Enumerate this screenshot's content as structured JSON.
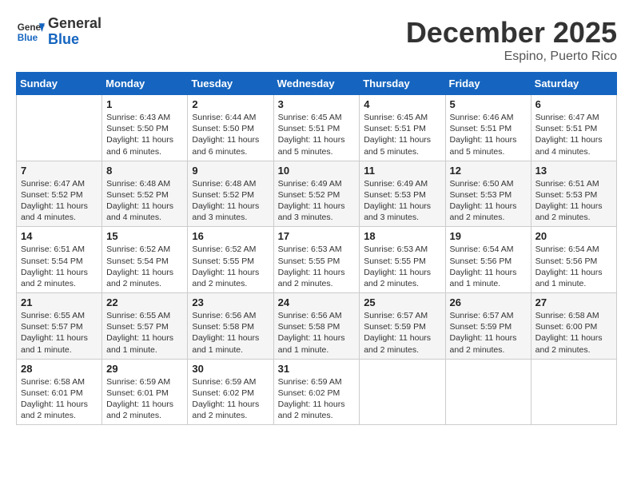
{
  "header": {
    "logo_general": "General",
    "logo_blue": "Blue",
    "month_title": "December 2025",
    "location": "Espino, Puerto Rico"
  },
  "days_of_week": [
    "Sunday",
    "Monday",
    "Tuesday",
    "Wednesday",
    "Thursday",
    "Friday",
    "Saturday"
  ],
  "weeks": [
    [
      {
        "day": "",
        "info": ""
      },
      {
        "day": "1",
        "info": "Sunrise: 6:43 AM\nSunset: 5:50 PM\nDaylight: 11 hours\nand 6 minutes."
      },
      {
        "day": "2",
        "info": "Sunrise: 6:44 AM\nSunset: 5:50 PM\nDaylight: 11 hours\nand 6 minutes."
      },
      {
        "day": "3",
        "info": "Sunrise: 6:45 AM\nSunset: 5:51 PM\nDaylight: 11 hours\nand 5 minutes."
      },
      {
        "day": "4",
        "info": "Sunrise: 6:45 AM\nSunset: 5:51 PM\nDaylight: 11 hours\nand 5 minutes."
      },
      {
        "day": "5",
        "info": "Sunrise: 6:46 AM\nSunset: 5:51 PM\nDaylight: 11 hours\nand 5 minutes."
      },
      {
        "day": "6",
        "info": "Sunrise: 6:47 AM\nSunset: 5:51 PM\nDaylight: 11 hours\nand 4 minutes."
      }
    ],
    [
      {
        "day": "7",
        "info": "Sunrise: 6:47 AM\nSunset: 5:52 PM\nDaylight: 11 hours\nand 4 minutes."
      },
      {
        "day": "8",
        "info": "Sunrise: 6:48 AM\nSunset: 5:52 PM\nDaylight: 11 hours\nand 4 minutes."
      },
      {
        "day": "9",
        "info": "Sunrise: 6:48 AM\nSunset: 5:52 PM\nDaylight: 11 hours\nand 3 minutes."
      },
      {
        "day": "10",
        "info": "Sunrise: 6:49 AM\nSunset: 5:52 PM\nDaylight: 11 hours\nand 3 minutes."
      },
      {
        "day": "11",
        "info": "Sunrise: 6:49 AM\nSunset: 5:53 PM\nDaylight: 11 hours\nand 3 minutes."
      },
      {
        "day": "12",
        "info": "Sunrise: 6:50 AM\nSunset: 5:53 PM\nDaylight: 11 hours\nand 2 minutes."
      },
      {
        "day": "13",
        "info": "Sunrise: 6:51 AM\nSunset: 5:53 PM\nDaylight: 11 hours\nand 2 minutes."
      }
    ],
    [
      {
        "day": "14",
        "info": "Sunrise: 6:51 AM\nSunset: 5:54 PM\nDaylight: 11 hours\nand 2 minutes."
      },
      {
        "day": "15",
        "info": "Sunrise: 6:52 AM\nSunset: 5:54 PM\nDaylight: 11 hours\nand 2 minutes."
      },
      {
        "day": "16",
        "info": "Sunrise: 6:52 AM\nSunset: 5:55 PM\nDaylight: 11 hours\nand 2 minutes."
      },
      {
        "day": "17",
        "info": "Sunrise: 6:53 AM\nSunset: 5:55 PM\nDaylight: 11 hours\nand 2 minutes."
      },
      {
        "day": "18",
        "info": "Sunrise: 6:53 AM\nSunset: 5:55 PM\nDaylight: 11 hours\nand 2 minutes."
      },
      {
        "day": "19",
        "info": "Sunrise: 6:54 AM\nSunset: 5:56 PM\nDaylight: 11 hours\nand 1 minute."
      },
      {
        "day": "20",
        "info": "Sunrise: 6:54 AM\nSunset: 5:56 PM\nDaylight: 11 hours\nand 1 minute."
      }
    ],
    [
      {
        "day": "21",
        "info": "Sunrise: 6:55 AM\nSunset: 5:57 PM\nDaylight: 11 hours\nand 1 minute."
      },
      {
        "day": "22",
        "info": "Sunrise: 6:55 AM\nSunset: 5:57 PM\nDaylight: 11 hours\nand 1 minute."
      },
      {
        "day": "23",
        "info": "Sunrise: 6:56 AM\nSunset: 5:58 PM\nDaylight: 11 hours\nand 1 minute."
      },
      {
        "day": "24",
        "info": "Sunrise: 6:56 AM\nSunset: 5:58 PM\nDaylight: 11 hours\nand 1 minute."
      },
      {
        "day": "25",
        "info": "Sunrise: 6:57 AM\nSunset: 5:59 PM\nDaylight: 11 hours\nand 2 minutes."
      },
      {
        "day": "26",
        "info": "Sunrise: 6:57 AM\nSunset: 5:59 PM\nDaylight: 11 hours\nand 2 minutes."
      },
      {
        "day": "27",
        "info": "Sunrise: 6:58 AM\nSunset: 6:00 PM\nDaylight: 11 hours\nand 2 minutes."
      }
    ],
    [
      {
        "day": "28",
        "info": "Sunrise: 6:58 AM\nSunset: 6:01 PM\nDaylight: 11 hours\nand 2 minutes."
      },
      {
        "day": "29",
        "info": "Sunrise: 6:59 AM\nSunset: 6:01 PM\nDaylight: 11 hours\nand 2 minutes."
      },
      {
        "day": "30",
        "info": "Sunrise: 6:59 AM\nSunset: 6:02 PM\nDaylight: 11 hours\nand 2 minutes."
      },
      {
        "day": "31",
        "info": "Sunrise: 6:59 AM\nSunset: 6:02 PM\nDaylight: 11 hours\nand 2 minutes."
      },
      {
        "day": "",
        "info": ""
      },
      {
        "day": "",
        "info": ""
      },
      {
        "day": "",
        "info": ""
      }
    ]
  ]
}
